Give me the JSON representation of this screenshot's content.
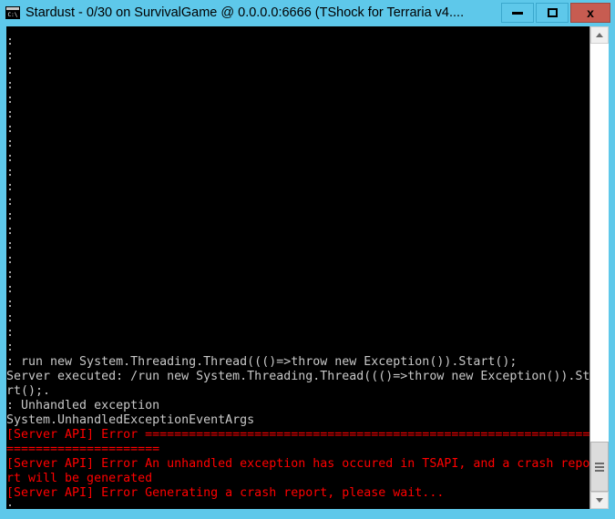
{
  "window": {
    "title": "Stardust - 0/30 on SurvivalGame @ 0.0.0.0:6666 (TShock for Terraria v4....",
    "icon": "console-app-icon",
    "frame_color": "#5ec8ea",
    "console_background": "#000000",
    "console_text_color": "#c8c8c8",
    "error_text_color": "#ff0000"
  },
  "titlebar": {
    "minimize_label": "–",
    "maximize_label": "□",
    "close_label": "x"
  },
  "console": {
    "prompt_filler_line": ":",
    "prompt_filler_count": 22,
    "lines": [
      {
        "text": ": run new System.Threading.Thread((()=>throw new Exception()).Start();",
        "color": "white"
      },
      {
        "text": "Server executed: /run new System.Threading.Thread((()=>throw new Exception()).Sta",
        "color": "white"
      },
      {
        "text": "rt();.",
        "color": "white"
      },
      {
        "text": ": Unhandled exception",
        "color": "white"
      },
      {
        "text": "System.UnhandledExceptionEventArgs",
        "color": "white"
      },
      {
        "text": "[Server API] Error ==============================================================",
        "color": "red"
      },
      {
        "text": "=====================",
        "color": "red"
      },
      {
        "text": "[Server API] Error An unhandled exception has occured in TSAPI, and a crash repo",
        "color": "red"
      },
      {
        "text": "rt will be generated",
        "color": "red"
      },
      {
        "text": "[Server API] Error Generating a crash report, please wait...",
        "color": "red"
      },
      {
        "text": ":",
        "color": "white"
      }
    ]
  },
  "scrollbar": {
    "up_arrow": "scroll-up-arrow",
    "down_arrow": "scroll-down-arrow",
    "thumb": "scroll-thumb"
  }
}
